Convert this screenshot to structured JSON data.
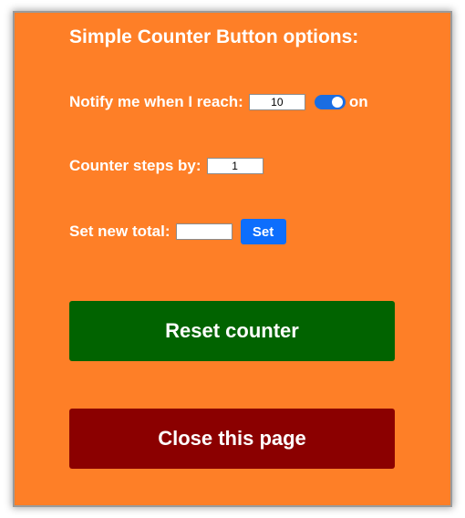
{
  "title": "Simple Counter Button options:",
  "notify": {
    "label": "Notify me when I reach:",
    "value": "10",
    "toggle_state_label": "on",
    "toggle_on": true
  },
  "steps": {
    "label": "Counter steps by:",
    "value": "1"
  },
  "new_total": {
    "label": "Set new total:",
    "value": "",
    "button_label": "Set"
  },
  "buttons": {
    "reset_label": "Reset counter",
    "close_label": "Close this page"
  },
  "colors": {
    "panel_bg": "#fe7f27",
    "reset_bg": "#016300",
    "close_bg": "#8b0000",
    "set_bg": "#0d6efd",
    "toggle_bg": "#1a6de2"
  }
}
